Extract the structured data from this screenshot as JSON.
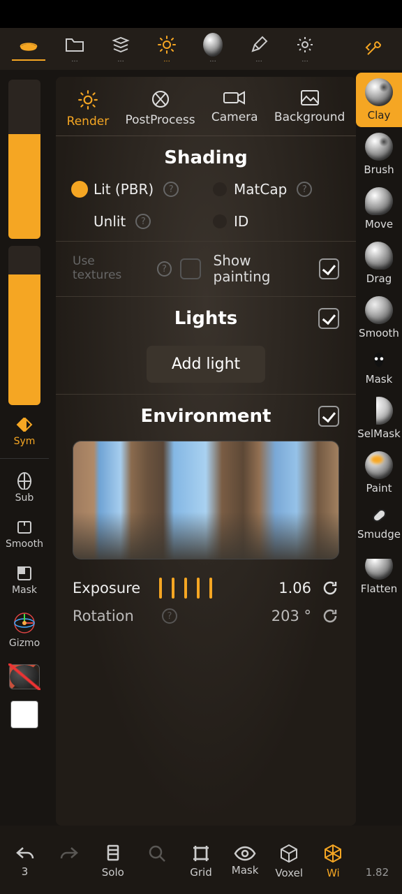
{
  "toolbar": {
    "dots": "..."
  },
  "panel": {
    "tabs": {
      "render": "Render",
      "postprocess": "PostProcess",
      "camera": "Camera",
      "background": "Background"
    },
    "shading": {
      "title": "Shading",
      "lit": "Lit (PBR)",
      "matcap": "MatCap",
      "unlit": "Unlit",
      "id": "ID",
      "use_textures": "Use textures",
      "show_painting": "Show painting"
    },
    "lights": {
      "title": "Lights",
      "add": "Add light"
    },
    "environment": {
      "title": "Environment",
      "exposure_label": "Exposure",
      "exposure_value": "1.06",
      "rotation_label": "Rotation",
      "rotation_value": "203 °"
    }
  },
  "left": {
    "sym": "Sym",
    "sub": "Sub",
    "smooth": "Smooth",
    "mask": "Mask",
    "gizmo": "Gizmo"
  },
  "right": {
    "clay": "Clay",
    "brush": "Brush",
    "move": "Move",
    "drag": "Drag",
    "smooth": "Smooth",
    "mask": "Mask",
    "selmask": "SelMask",
    "paint": "Paint",
    "smudge": "Smudge",
    "flatten": "Flatten"
  },
  "bottom": {
    "undo_count": "3",
    "solo": "Solo",
    "grid": "Grid",
    "mask": "Mask",
    "voxel": "Voxel",
    "wire": "Wi",
    "zoom": "1.82"
  }
}
